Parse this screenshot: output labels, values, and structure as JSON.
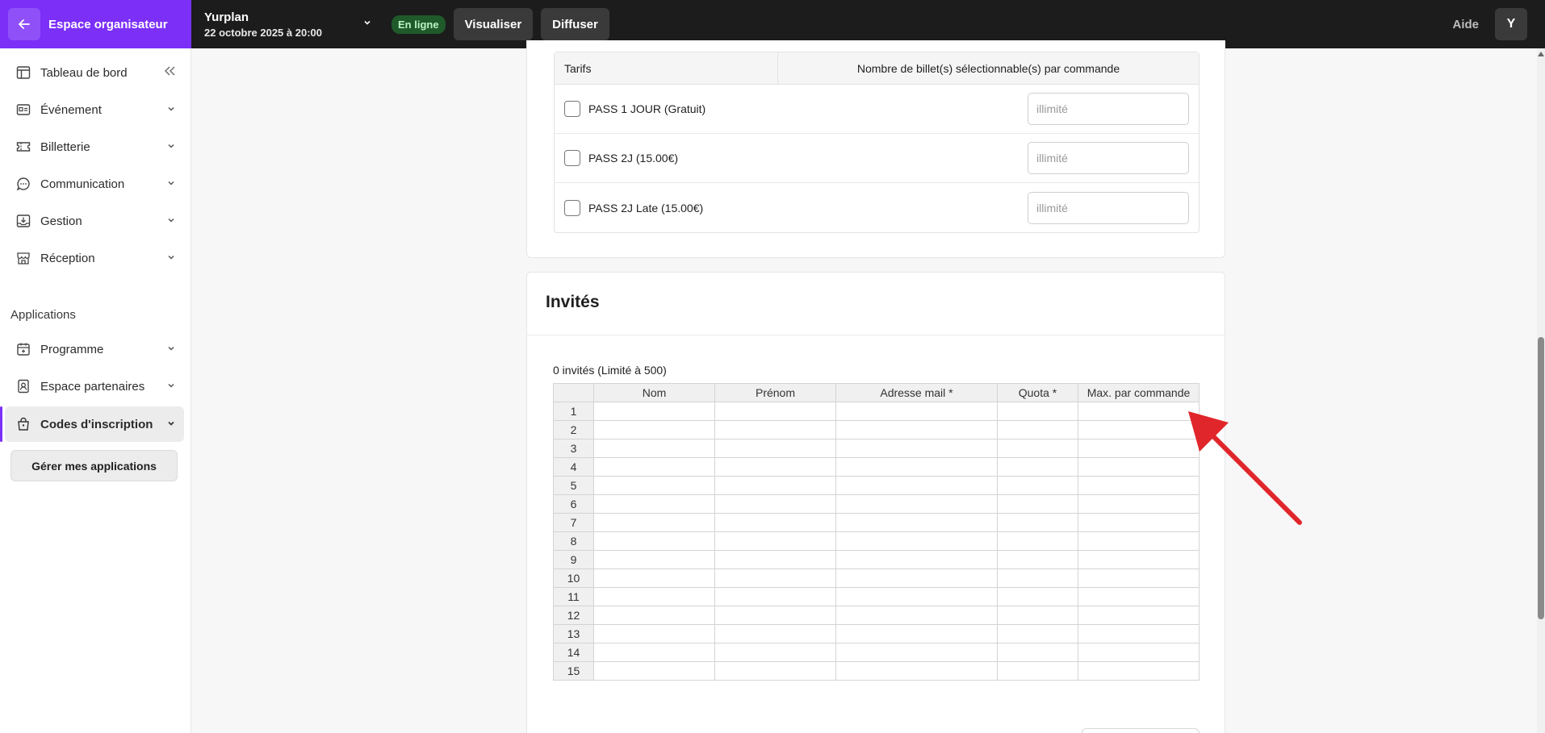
{
  "topbar": {
    "org_label": "Espace organisateur",
    "event_name": "Yurplan",
    "event_date": "22 octobre 2025 à 20:00",
    "status_badge": "En ligne",
    "preview_btn": "Visualiser",
    "broadcast_btn": "Diffuser",
    "help_label": "Aide",
    "avatar_initial": "Y"
  },
  "sidebar": {
    "items": [
      {
        "label": "Tableau de bord",
        "icon": "layout-icon"
      },
      {
        "label": "Événement",
        "icon": "id-card-icon"
      },
      {
        "label": "Billetterie",
        "icon": "ticket-icon"
      },
      {
        "label": "Communication",
        "icon": "chat-icon"
      },
      {
        "label": "Gestion",
        "icon": "download-tray-icon"
      },
      {
        "label": "Réception",
        "icon": "store-icon"
      }
    ],
    "apps_label": "Applications",
    "apps": [
      {
        "label": "Programme",
        "icon": "calendar-icon"
      },
      {
        "label": "Espace partenaires",
        "icon": "badge-icon"
      },
      {
        "label": "Codes d'inscription",
        "icon": "lock-bag-icon"
      }
    ],
    "manage_btn": "Gérer mes applications"
  },
  "tarifs": {
    "col_tarifs": "Tarifs",
    "col_nombre": "Nombre de billet(s) sélectionnable(s) par commande",
    "rows": [
      {
        "label": "PASS 1 JOUR (Gratuit)",
        "placeholder": "illimité"
      },
      {
        "label": "PASS 2J (15.00€)",
        "placeholder": "illimité"
      },
      {
        "label": "PASS 2J Late (15.00€)",
        "placeholder": "illimité"
      }
    ]
  },
  "invites": {
    "title": "Invités",
    "count_text": "0 invités (Limité à 500)",
    "columns": [
      "Nom",
      "Prénom",
      "Adresse mail *",
      "Quota *",
      "Max. par commande"
    ],
    "rows": [
      "1",
      "2",
      "3",
      "4",
      "5",
      "6",
      "7",
      "8",
      "9",
      "10",
      "11",
      "12",
      "13",
      "14",
      "15"
    ]
  },
  "colors": {
    "accent": "#7b2ff7",
    "annotation_arrow": "#e0262b"
  }
}
